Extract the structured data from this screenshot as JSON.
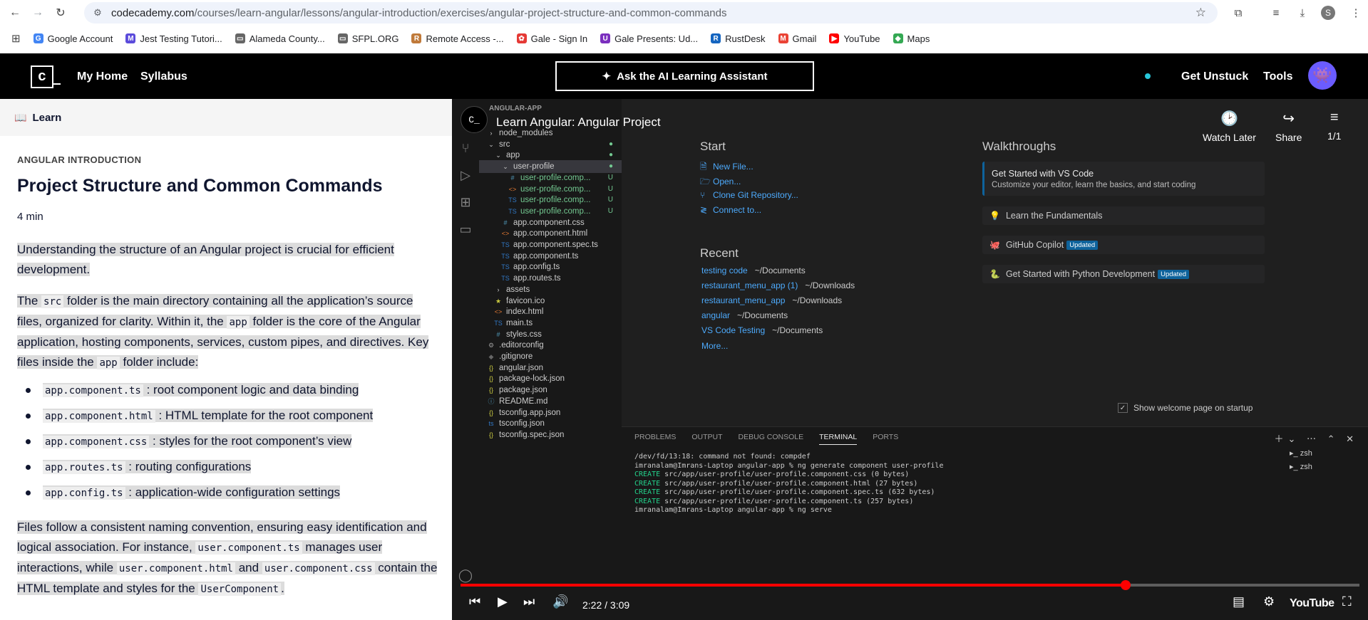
{
  "browser": {
    "url_host": "codecademy.com",
    "url_path": "/courses/learn-angular/lessons/angular-introduction/exercises/angular-project-structure-and-common-commands",
    "profile_initial": "S",
    "bookmarks": [
      {
        "label": "Google Account",
        "color": "#4285f4",
        "glyph": "G"
      },
      {
        "label": "Jest Testing Tutori...",
        "color": "#5b4bdb",
        "glyph": "M"
      },
      {
        "label": "Alameda County...",
        "color": "#666666",
        "glyph": "▭"
      },
      {
        "label": "SFPL.ORG",
        "color": "#666666",
        "glyph": "▭"
      },
      {
        "label": "Remote Access -...",
        "color": "#c07a3a",
        "glyph": "R"
      },
      {
        "label": "Gale - Sign In",
        "color": "#e53935",
        "glyph": "✿"
      },
      {
        "label": "Gale Presents: Ud...",
        "color": "#7b2fbe",
        "glyph": "U"
      },
      {
        "label": "RustDesk",
        "color": "#1565c0",
        "glyph": "R"
      },
      {
        "label": "Gmail",
        "color": "#ea4335",
        "glyph": "M"
      },
      {
        "label": "YouTube",
        "color": "#ff0000",
        "glyph": "▶"
      },
      {
        "label": "Maps",
        "color": "#34a853",
        "glyph": "◆"
      }
    ]
  },
  "header": {
    "my_home": "My Home",
    "syllabus": "Syllabus",
    "ai_assistant": "Ask the AI Learning Assistant",
    "get_unstuck": "Get Unstuck",
    "tools": "Tools",
    "logo_text": "c"
  },
  "lesson": {
    "learn_label": "Learn",
    "kicker": "ANGULAR INTRODUCTION",
    "title": "Project Structure and Common Commands",
    "duration": "4 min",
    "intro": "Understanding the structure of an Angular project is crucial for efficient development.",
    "p2_a": "The ",
    "p2_code1": "src",
    "p2_b": " folder is the main directory containing all the application’s source files, organized for clarity. Within it, the ",
    "p2_code2": "app",
    "p2_c": " folder is the core of the Angular application, hosting components, services, custom pipes, and directives. Key files inside the ",
    "p2_code3": "app",
    "p2_d": " folder include:",
    "bullets": [
      {
        "code": "app.component.ts",
        "text": ": root component logic and data binding"
      },
      {
        "code": "app.component.html",
        "text": ": HTML template for the root component"
      },
      {
        "code": "app.component.css",
        "text": ": styles for the root component’s view"
      },
      {
        "code": "app.routes.ts",
        "text": ": routing configurations"
      },
      {
        "code": "app.config.ts",
        "text": ": application-wide configuration settings"
      }
    ],
    "p3_a": "Files follow a consistent naming convention, ensuring easy identification and logical association. For instance, ",
    "p3_code1": "user.component.ts",
    "p3_b": " manages user interactions, while ",
    "p3_code2": "user.component.html",
    "p3_c": " and ",
    "p3_code3": "user.component.css",
    "p3_d": " contain the HTML template and styles for the ",
    "p3_code4": "UserComponent",
    "p3_e": "."
  },
  "vscode": {
    "explorer_title": "ANGULAR-APP",
    "files": [
      {
        "name": "node_modules",
        "icon": "›",
        "indent": 1,
        "mark": ""
      },
      {
        "name": "src",
        "icon": "⌄",
        "indent": 1,
        "mark": "●"
      },
      {
        "name": "app",
        "icon": "⌄",
        "indent": 2,
        "mark": "●"
      },
      {
        "name": "user-profile",
        "icon": "⌄",
        "indent": 3,
        "mark": "●",
        "selected": true
      },
      {
        "name": "user-profile.comp...",
        "icon": "#",
        "indent": 4,
        "mark": "U"
      },
      {
        "name": "user-profile.comp...",
        "icon": "<>",
        "indent": 4,
        "mark": "U"
      },
      {
        "name": "user-profile.comp...",
        "icon": "TS",
        "indent": 4,
        "mark": "U"
      },
      {
        "name": "user-profile.comp...",
        "icon": "TS",
        "indent": 4,
        "mark": "U"
      },
      {
        "name": "app.component.css",
        "icon": "#",
        "indent": 3,
        "mark": ""
      },
      {
        "name": "app.component.html",
        "icon": "<>",
        "indent": 3,
        "mark": ""
      },
      {
        "name": "app.component.spec.ts",
        "icon": "TS",
        "indent": 3,
        "mark": ""
      },
      {
        "name": "app.component.ts",
        "icon": "TS",
        "indent": 3,
        "mark": ""
      },
      {
        "name": "app.config.ts",
        "icon": "TS",
        "indent": 3,
        "mark": ""
      },
      {
        "name": "app.routes.ts",
        "icon": "TS",
        "indent": 3,
        "mark": ""
      },
      {
        "name": "assets",
        "icon": "›",
        "indent": 2,
        "mark": ""
      },
      {
        "name": "favicon.ico",
        "icon": "★",
        "indent": 2,
        "mark": ""
      },
      {
        "name": "index.html",
        "icon": "<>",
        "indent": 2,
        "mark": ""
      },
      {
        "name": "main.ts",
        "icon": "TS",
        "indent": 2,
        "mark": ""
      },
      {
        "name": "styles.css",
        "icon": "#",
        "indent": 2,
        "mark": ""
      },
      {
        "name": ".editorconfig",
        "icon": "⚙",
        "indent": 1,
        "mark": ""
      },
      {
        "name": ".gitignore",
        "icon": "◆",
        "indent": 1,
        "mark": ""
      },
      {
        "name": "angular.json",
        "icon": "{}",
        "indent": 1,
        "mark": ""
      },
      {
        "name": "package-lock.json",
        "icon": "{}",
        "indent": 1,
        "mark": ""
      },
      {
        "name": "package.json",
        "icon": "{}",
        "indent": 1,
        "mark": ""
      },
      {
        "name": "README.md",
        "icon": "ⓘ",
        "indent": 1,
        "mark": ""
      },
      {
        "name": "tsconfig.app.json",
        "icon": "{}",
        "indent": 1,
        "mark": ""
      },
      {
        "name": "tsconfig.json",
        "icon": "ts",
        "indent": 1,
        "mark": ""
      },
      {
        "name": "tsconfig.spec.json",
        "icon": "{}",
        "indent": 1,
        "mark": ""
      }
    ],
    "start_heading": "Start",
    "start_links": [
      "New File...",
      "Open...",
      "Clone Git Repository...",
      "Connect to..."
    ],
    "recent_heading": "Recent",
    "recent": [
      {
        "name": "testing code",
        "path": "~/Documents"
      },
      {
        "name": "restaurant_menu_app (1)",
        "path": "~/Downloads"
      },
      {
        "name": "restaurant_menu_app",
        "path": "~/Downloads"
      },
      {
        "name": "angular",
        "path": "~/Documents"
      },
      {
        "name": "VS Code Testing",
        "path": "~/Documents"
      }
    ],
    "more": "More...",
    "walkthroughs_heading": "Walkthroughs",
    "walkthrough_main_title": "Get Started with VS Code",
    "walkthrough_main_desc": "Customize your editor, learn the basics, and start coding",
    "walkthroughs": [
      {
        "title": "Learn the Fundamentals",
        "badge": ""
      },
      {
        "title": "GitHub Copilot",
        "badge": "Updated"
      },
      {
        "title": "Get Started with Python Development",
        "badge": "Updated"
      }
    ],
    "show_welcome": "Show welcome page on startup",
    "panel_tabs": [
      "PROBLEMS",
      "OUTPUT",
      "DEBUG CONSOLE",
      "TERMINAL",
      "PORTS"
    ],
    "terminal_lines": [
      "/dev/fd/13:18: command not found: compdef",
      "imranalam@Imrans-Laptop angular-app % ng generate component user-profile",
      "CREATE src/app/user-profile/user-profile.component.css (0 bytes)",
      "CREATE src/app/user-profile/user-profile.component.html (27 bytes)",
      "CREATE src/app/user-profile/user-profile.component.spec.ts (632 bytes)",
      "CREATE src/app/user-profile/user-profile.component.ts (257 bytes)",
      "imranalam@Imrans-Laptop angular-app % ng serve"
    ],
    "terminals": [
      "zsh",
      "zsh"
    ]
  },
  "video": {
    "title": "Learn Angular: Angular Project",
    "watch_later": "Watch Later",
    "share": "Share",
    "playlist": "1/1",
    "time": "2:22 / 3:09",
    "progress_fraction": 0.74,
    "brand": "YouTube",
    "colors": {
      "progress": "#ff0000",
      "accent": "#27c6d9"
    }
  }
}
